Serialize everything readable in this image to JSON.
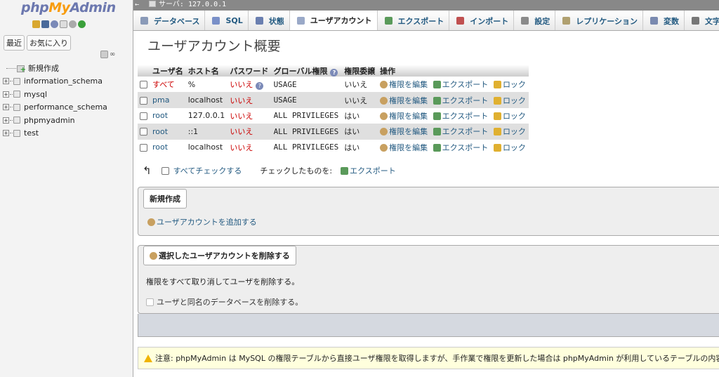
{
  "app": {
    "logo_php": "php",
    "logo_my": "My",
    "logo_admin": "Admin"
  },
  "sidebar": {
    "recent_label": "最近",
    "favorites_label": "お気に入り",
    "collapse_symbol": "⊖",
    "link_symbol": "∞",
    "new_label": "新規作成",
    "databases": [
      "information_schema",
      "mysql",
      "performance_schema",
      "phpmyadmin",
      "test"
    ]
  },
  "serverbar": {
    "text": "サーバ: 127.0.0.1"
  },
  "tabs": [
    {
      "label": "データベース",
      "icon": "database-icon",
      "color": "#8a9ab8"
    },
    {
      "label": "SQL",
      "icon": "sql-icon",
      "color": "#7a90c8"
    },
    {
      "label": "状態",
      "icon": "status-icon",
      "color": "#6a7fb0"
    },
    {
      "label": "ユーザアカウント",
      "icon": "users-icon",
      "color": "#9aa9c8",
      "active": true
    },
    {
      "label": "エクスポート",
      "icon": "export-icon",
      "color": "#5a9a5a"
    },
    {
      "label": "インポート",
      "icon": "import-icon",
      "color": "#c05050"
    },
    {
      "label": "設定",
      "icon": "wrench-icon",
      "color": "#8a8a8a"
    },
    {
      "label": "レプリケーション",
      "icon": "replication-icon",
      "color": "#b0a070"
    },
    {
      "label": "変数",
      "icon": "variables-icon",
      "color": "#7a8ab0"
    },
    {
      "label": "文字セ",
      "icon": "charset-icon",
      "color": "#777"
    }
  ],
  "main": {
    "title": "ユーザアカウント概要",
    "columns": [
      "ユーザ名",
      "ホスト名",
      "パスワード",
      "グローバル権限",
      "権限委譲",
      "操作"
    ],
    "rows": [
      {
        "user": "すべて",
        "host": "%",
        "password": "いいえ",
        "privileges": "USAGE",
        "grant": "いいえ",
        "user_red": true,
        "pw_help": true
      },
      {
        "user": "pma",
        "host": "localhost",
        "password": "いいえ",
        "privileges": "USAGE",
        "grant": "いいえ"
      },
      {
        "user": "root",
        "host": "127.0.0.1",
        "password": "いいえ",
        "privileges": "ALL PRIVILEGES",
        "grant": "はい"
      },
      {
        "user": "root",
        "host": "::1",
        "password": "いいえ",
        "privileges": "ALL PRIVILEGES",
        "grant": "はい"
      },
      {
        "user": "root",
        "host": "localhost",
        "password": "いいえ",
        "privileges": "ALL PRIVILEGES",
        "grant": "はい"
      }
    ],
    "actions": {
      "edit": "権限を編集",
      "export": "エクスポート",
      "lock": "ロック"
    },
    "check_all": "すべてチェックする",
    "with_selected": "チェックしたものを:",
    "with_selected_export": "エクスポート"
  },
  "new_section": {
    "legend": "新規作成",
    "add_user": "ユーザアカウントを追加する"
  },
  "delete_section": {
    "legend": "選択したユーザアカウントを削除する",
    "desc": "権限をすべて取り消してユーザを削除する。",
    "drop_db": "ユーザと同名のデータベースを削除する。"
  },
  "notice": {
    "text": "注意: phpMyAdmin は MySQL の権限テーブルから直接ユーザ権限を取得しますが、手作業で権限を更新した場合は phpMyAdmin が利用しているテーブルの内容とサーバ"
  },
  "colors": {
    "link": "#235a81",
    "negative": "#cc0000",
    "row_alt": "#dfdfdf",
    "notice_bg": "#ffffdd"
  }
}
